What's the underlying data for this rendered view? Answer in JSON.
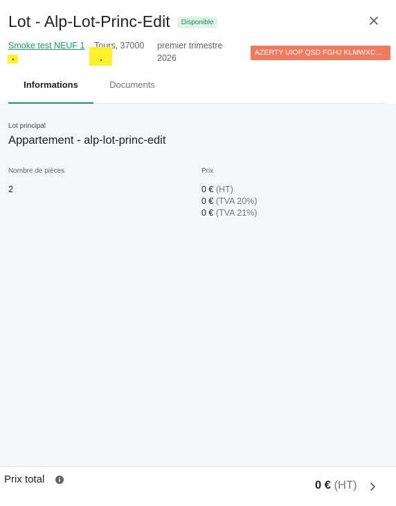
{
  "header": {
    "title": "Lot - Alp-Lot-Princ-Edit",
    "status_badge": "Disponible",
    "program_link": "Smoke test NEUF 1",
    "city": "Tours, 37000",
    "delivery": "premier trimestre 2026",
    "tag_label": "AZERTY UIOP QSD FGHJ KLMWXC..."
  },
  "tabs": [
    {
      "label": "Informations",
      "active": true
    },
    {
      "label": "Documents",
      "active": false
    }
  ],
  "main": {
    "section_label": "Lot principal",
    "section_title": "Appartement - alp-lot-princ-edit",
    "rooms_label": "Nombre de pièces",
    "rooms_value": "2",
    "price_label": "Prix",
    "prices": [
      {
        "amount": "0 €",
        "unit": "(HT)"
      },
      {
        "amount": "0 €",
        "unit": "(TVA 20%)"
      },
      {
        "amount": "0 €",
        "unit": "(TVA 21%)"
      }
    ]
  },
  "footer": {
    "label": "Prix total",
    "total_amount": "0 €",
    "total_unit": "(HT)"
  },
  "colors": {
    "accent": "#1f8a6e",
    "link": "#1a9a6c",
    "tag_bg": "#f07a5d",
    "badge_bg": "#dff3ea",
    "content_bg": "#f5f6f7",
    "highlight": "#fdf22c"
  },
  "icons": [
    "close-icon",
    "info-icon",
    "chevron-right-icon"
  ]
}
